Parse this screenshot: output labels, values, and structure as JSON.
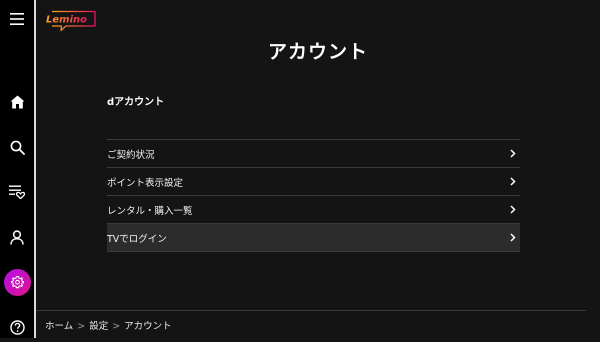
{
  "app": {
    "logo_text": "Lemino"
  },
  "sidebar": {
    "items": [
      {
        "name": "menu",
        "icon": "hamburger-icon"
      },
      {
        "name": "home",
        "icon": "home-icon"
      },
      {
        "name": "search",
        "icon": "search-icon"
      },
      {
        "name": "mylist",
        "icon": "list-heart-icon"
      },
      {
        "name": "profile",
        "icon": "person-icon"
      },
      {
        "name": "settings",
        "icon": "gear-icon",
        "active": true
      },
      {
        "name": "help",
        "icon": "help-icon"
      }
    ],
    "active_gradient": [
      "#b10fe8",
      "#e0148c"
    ]
  },
  "main": {
    "title": "アカウント",
    "section_title": "dアカウント",
    "menu_items": [
      {
        "label": "ご契約状況"
      },
      {
        "label": "ポイント表示設定"
      },
      {
        "label": "レンタル・購入一覧"
      },
      {
        "label": "TVでログイン"
      }
    ]
  },
  "breadcrumb": {
    "items": [
      "ホーム",
      "設定",
      "アカウント"
    ],
    "separator": ">"
  },
  "colors": {
    "background": "#141414",
    "sidebar": "#000000",
    "logo_gradient": [
      "#f5a623",
      "#e8125c"
    ]
  }
}
